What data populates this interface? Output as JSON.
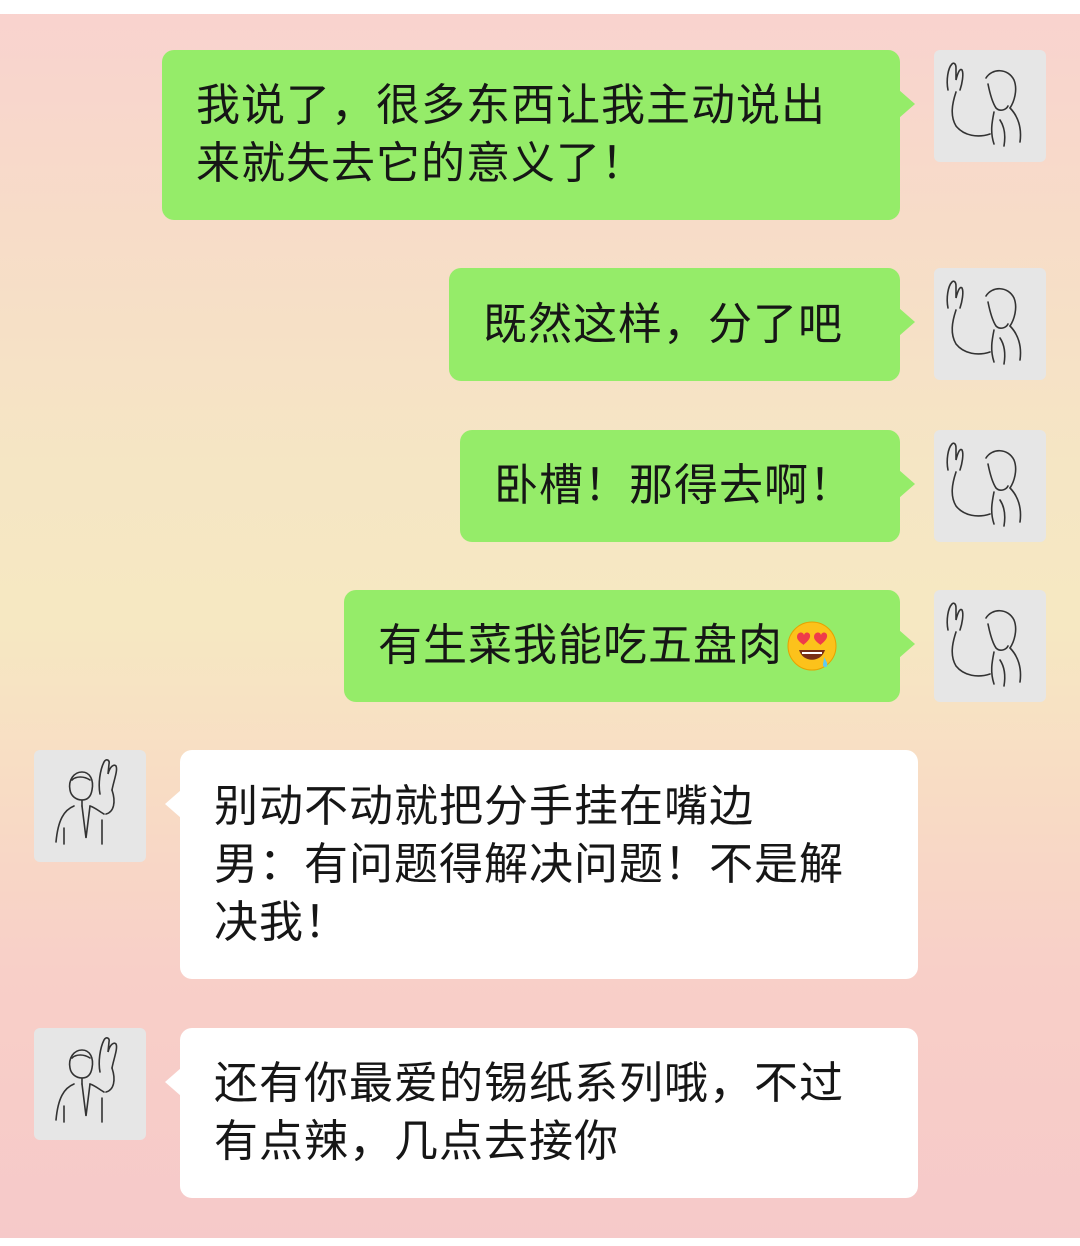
{
  "messages": [
    {
      "side": "right",
      "text": "我说了，很多东西让我主动说出\n来就失去它的意义了！",
      "avatar": "woman-waving-avatar"
    },
    {
      "side": "right",
      "text": "既然这样，分了吧",
      "avatar": "woman-waving-avatar"
    },
    {
      "side": "right",
      "text": "卧槽！那得去啊！",
      "avatar": "woman-waving-avatar"
    },
    {
      "side": "right",
      "text": "有生菜我能吃五盘肉",
      "emoji": "heart-eyes-drooling-emoji",
      "avatar": "woman-waving-avatar"
    },
    {
      "side": "left",
      "text": "别动不动就把分手挂在嘴边\n男：有问题得解决问题！不是解\n决我！",
      "avatar": "man-waving-avatar"
    },
    {
      "side": "left",
      "text": "还有你最爱的锡纸系列哦，不过\n有点辣，几点去接你",
      "avatar": "man-waving-avatar"
    }
  ],
  "colors": {
    "sent_bubble": "#95ec69",
    "received_bubble": "#ffffff",
    "avatar_bg": "#e6e6e6",
    "text": "#161616"
  }
}
